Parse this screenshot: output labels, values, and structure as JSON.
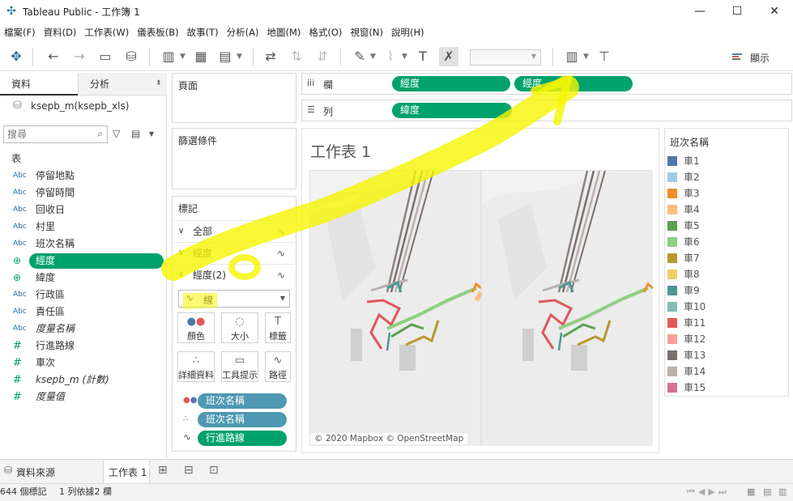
{
  "window": {
    "title": "Tableau Public - 工作簿 1",
    "minimize": "—",
    "maximize": "☐",
    "close": "✕"
  },
  "menu": [
    "檔案(F)",
    "資料(D)",
    "工作表(W)",
    "儀表板(B)",
    "故事(T)",
    "分析(A)",
    "地圖(M)",
    "格式(O)",
    "視窗(N)",
    "說明(H)"
  ],
  "toolbar": {
    "show_label": "顯示"
  },
  "left_panel": {
    "tab_data": "資料",
    "tab_analysis": "分析",
    "datasource": "ksepb_m(ksepb_xls)",
    "search_placeholder": "搜尋",
    "section": "表",
    "fields": [
      {
        "type": "Abc",
        "name": "停留地點"
      },
      {
        "type": "Abc",
        "name": "停留時間"
      },
      {
        "type": "Abc",
        "name": "回收日"
      },
      {
        "type": "Abc",
        "name": "村里"
      },
      {
        "type": "Abc",
        "name": "班次名稱"
      },
      {
        "type": "⊕",
        "name": "經度"
      },
      {
        "type": "⊕",
        "name": "緯度"
      },
      {
        "type": "Abc",
        "name": "行政區"
      },
      {
        "type": "Abc",
        "name": "責任區"
      },
      {
        "type": "Abc",
        "name": "度量名稱"
      },
      {
        "type": "#",
        "name": "行進路線"
      },
      {
        "type": "#",
        "name": "車次"
      },
      {
        "type": "#",
        "name": "ksepb_m (計數)"
      },
      {
        "type": "#",
        "name": "度量值"
      }
    ]
  },
  "pages_title": "頁面",
  "filters_title": "篩選條件",
  "marks": {
    "title": "標記",
    "rows": [
      "全部",
      "經度",
      "經度(2)"
    ],
    "mark_type": "線",
    "buttons": [
      "顏色",
      "大小",
      "標籤",
      "詳細資料",
      "工具提示",
      "路徑"
    ],
    "pills": [
      "班次名稱",
      "班次名稱",
      "行進路線"
    ]
  },
  "shelves": {
    "columns_label": "欄",
    "rows_label": "列",
    "columns_pills": [
      "經度",
      "經度"
    ],
    "rows_pills": [
      "緯度"
    ]
  },
  "view": {
    "sheet_title": "工作表 1",
    "attribution": "© 2020 Mapbox © OpenStreetMap"
  },
  "legend": {
    "title": "班次名稱",
    "items": [
      {
        "label": "車1",
        "color": "#4e79a7"
      },
      {
        "label": "車2",
        "color": "#a0cbe8"
      },
      {
        "label": "車3",
        "color": "#f28e2b"
      },
      {
        "label": "車4",
        "color": "#ffbe7d"
      },
      {
        "label": "車5",
        "color": "#59a14f"
      },
      {
        "label": "車6",
        "color": "#8cd17d"
      },
      {
        "label": "車7",
        "color": "#b6992d"
      },
      {
        "label": "車8",
        "color": "#f1ce63"
      },
      {
        "label": "車9",
        "color": "#499894"
      },
      {
        "label": "車10",
        "color": "#86bcb6"
      },
      {
        "label": "車11",
        "color": "#e15759"
      },
      {
        "label": "車12",
        "color": "#ff9d9a"
      },
      {
        "label": "車13",
        "color": "#79706e"
      },
      {
        "label": "車14",
        "color": "#bab0ac"
      },
      {
        "label": "車15",
        "color": "#d37295"
      }
    ]
  },
  "bottom": {
    "datasource_tab": "資料來源",
    "sheet_tab": "工作表 1",
    "status_marks": "644 個標記",
    "status_layout": "1 列依據2 欄"
  },
  "colors": {
    "accent_green": "#00a26b",
    "pill_blue": "#4e98b2",
    "highlighter": "#f5f500"
  }
}
